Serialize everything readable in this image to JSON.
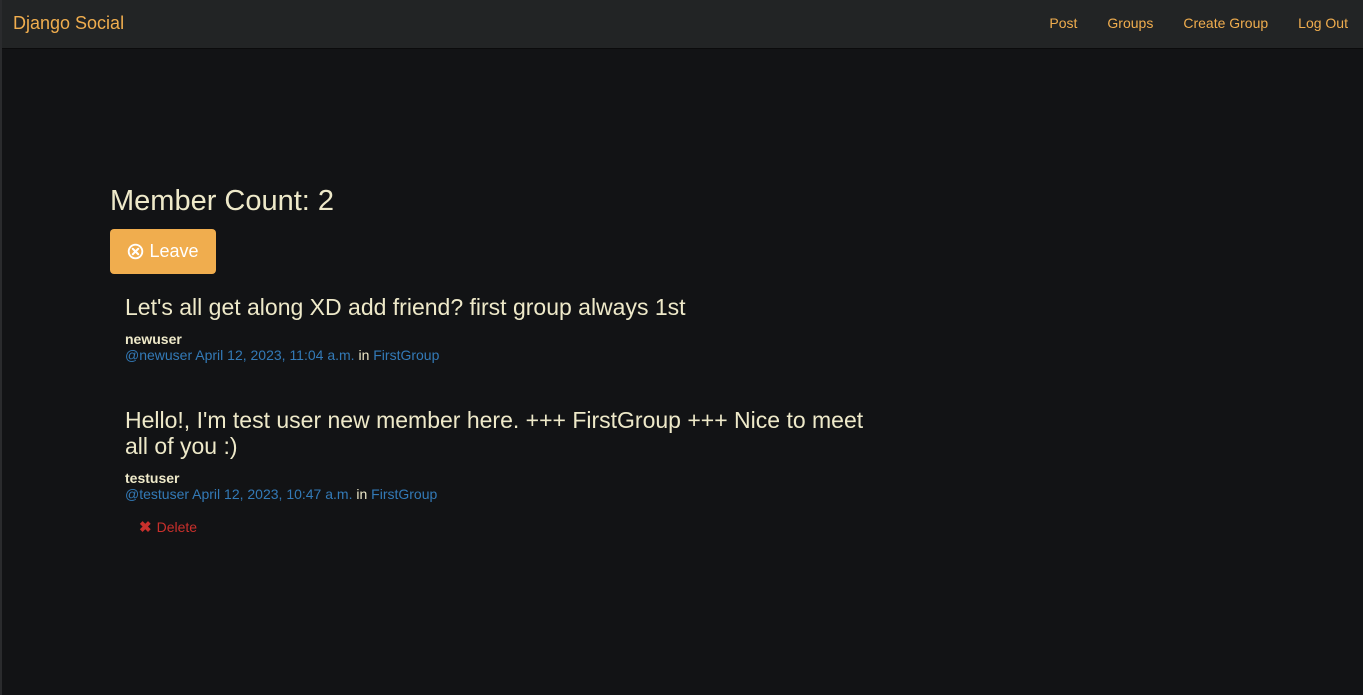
{
  "navbar": {
    "brand": "Django Social",
    "links": [
      {
        "label": "Post"
      },
      {
        "label": "Groups"
      },
      {
        "label": "Create Group"
      },
      {
        "label": "Log Out"
      }
    ]
  },
  "group": {
    "member_count_label": "Member Count: 2",
    "leave_label": "Leave"
  },
  "posts": [
    {
      "text": "Let's all get along XD add friend? first group always 1st",
      "username": "newuser",
      "handle": "@newuser",
      "timestamp": "April 12, 2023, 11:04 a.m.",
      "in_label": "in",
      "group": "FirstGroup"
    },
    {
      "text": "Hello!, I'm test user new member here. +++ FirstGroup +++ Nice to meet all of you :)",
      "username": "testuser",
      "handle": "@testuser",
      "timestamp": "April 12, 2023, 10:47 a.m.",
      "in_label": "in",
      "group": "FirstGroup",
      "delete_label": "Delete"
    }
  ],
  "colors": {
    "background": "#121315",
    "navbar": "#222425",
    "accent": "#f0ad4e",
    "text": "#eee9c9",
    "link": "#337ab7",
    "danger": "#c9302c"
  },
  "icons": {
    "leave": "remove-circle-icon",
    "delete": "close-icon"
  }
}
